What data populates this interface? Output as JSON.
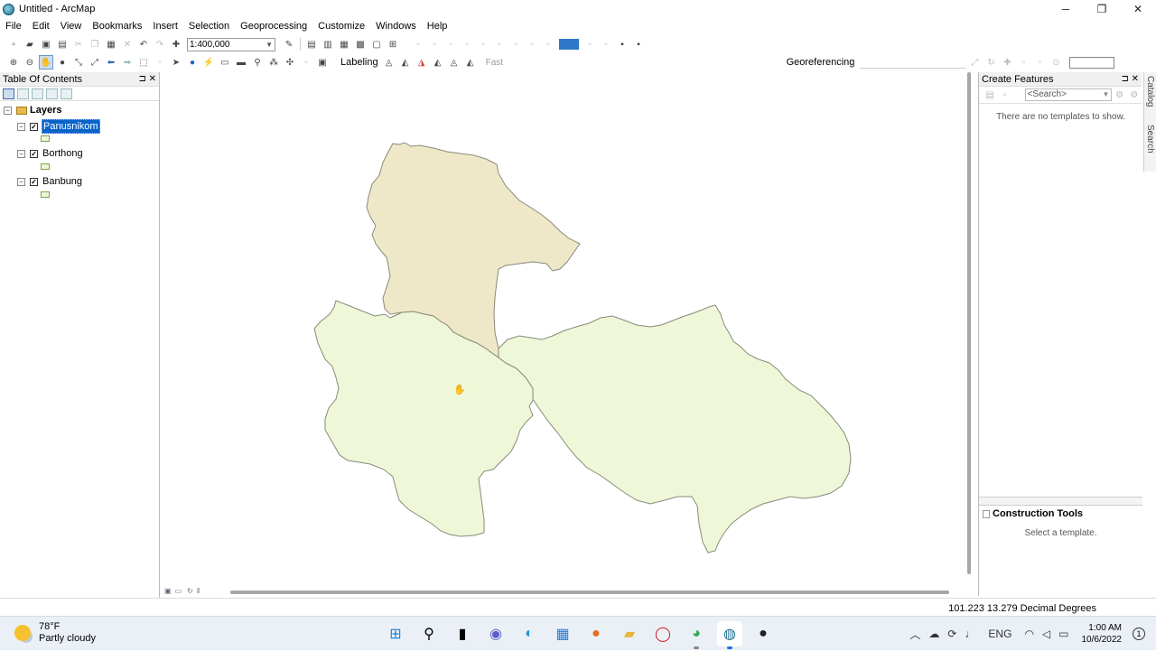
{
  "window": {
    "title": "Untitled - ArcMap",
    "min": "─",
    "max": "❐",
    "close": "✕"
  },
  "menu": [
    "File",
    "Edit",
    "View",
    "Bookmarks",
    "Insert",
    "Selection",
    "Geoprocessing",
    "Customize",
    "Windows",
    "Help"
  ],
  "toolbar": {
    "scale": "1:400,000",
    "labeling": "Labeling",
    "fast": "Fast",
    "georeferencing": "Georeferencing"
  },
  "toc": {
    "title": "Table Of Contents",
    "pins": "⊐ ✕",
    "root": "Layers",
    "layers": [
      {
        "name": "Panusnikom",
        "checked": true,
        "selected": true
      },
      {
        "name": "Borthong",
        "checked": true,
        "selected": false
      },
      {
        "name": "Banbung",
        "checked": true,
        "selected": false
      }
    ]
  },
  "map": {
    "fill_colors": {
      "Panusnikom": "#efe8c8",
      "Borthong": "#eef8d8",
      "Banbung": "#eef8d8"
    },
    "outline": "#8a8a7a"
  },
  "create_features": {
    "title": "Create Features",
    "pins": "⊐ ✕",
    "search_placeholder": "<Search>",
    "empty_msg": "There are no templates to show.",
    "construction_title": "Construction Tools",
    "construction_msg": "Select a template."
  },
  "sidetabs": {
    "catalog": "Catalog",
    "search": "Search"
  },
  "status": {
    "coords": "101.223  13.279 Decimal Degrees"
  },
  "taskbar": {
    "weather_temp": "78°F",
    "weather_desc": "Partly cloudy",
    "lang": "ENG",
    "time": "1:00 AM",
    "date": "10/6/2022",
    "notifications": "1"
  }
}
